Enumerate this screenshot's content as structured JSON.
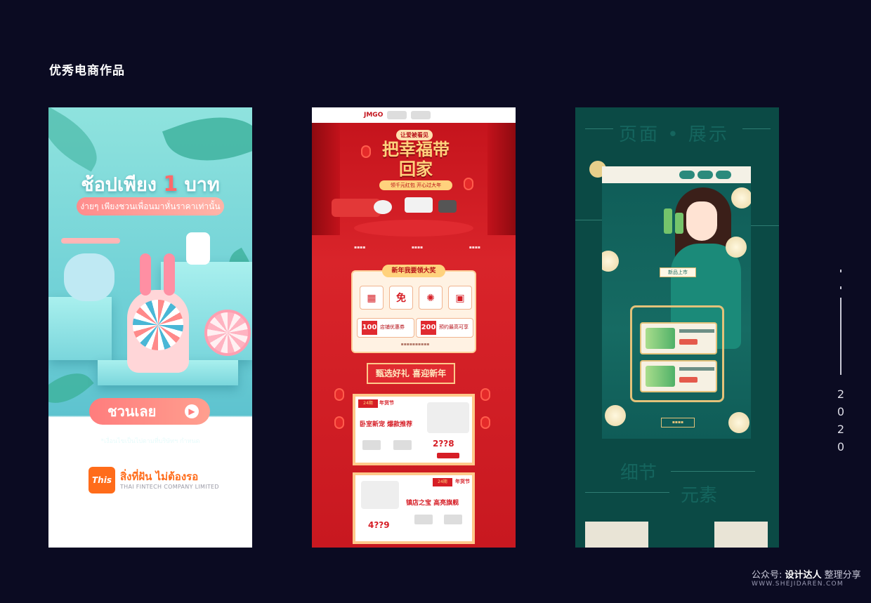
{
  "page": {
    "title": "优秀电商作品"
  },
  "cards": {
    "thai": {
      "headline_before": "ช้อปเพียง ",
      "headline_num": "1",
      "headline_after": " บาท",
      "subline": "ง่ายๆ เพียงชวนเพื่อนมาหั่นราคาเท่านั้น",
      "cta": "ชวนเลย",
      "disclaimer": "*เงื่อนไขเป็นไปตามที่บริษัทฯ กำหนด",
      "logo_text": "This",
      "slogan": "สิ่งที่ฝัน ไม่ต้องรอ",
      "company": "THAI FINTECH COMPANY LIMITED"
    },
    "cny": {
      "logo": "JMGO",
      "tag": "让爱被看见",
      "title": "把幸福带回家",
      "ribbon": "领千元红包 开心过大年",
      "panel_title": "新年我要领大奖",
      "coupon_1": "100",
      "coupon_1_label": "店铺优惠券",
      "coupon_2": "200",
      "coupon_2_label": "预约最高可享",
      "section_banner": "甄选好礼 喜迎新年",
      "promo_1_badge": "24期",
      "promo_1_tag": "年货节",
      "promo_1_head": "卧室新宠 爆款推荐",
      "promo_1_price": "2??8",
      "promo_2_badge": "24期",
      "promo_2_tag": "年货节",
      "promo_2_head": "镇店之宝 高亮旗舰",
      "promo_2_price": "4??9"
    },
    "green": {
      "title_1": "页面",
      "title_2": "展示",
      "sign": "新品上市",
      "sub_1": "细节",
      "sub_2": "元素"
    }
  },
  "year_digits": [
    "2",
    "0",
    "2",
    "0"
  ],
  "watermark": {
    "prefix": "公众号: ",
    "name": "设计达人",
    "suffix": " 整理分享",
    "url": "WWW.SHEJIDAREN.COM"
  }
}
